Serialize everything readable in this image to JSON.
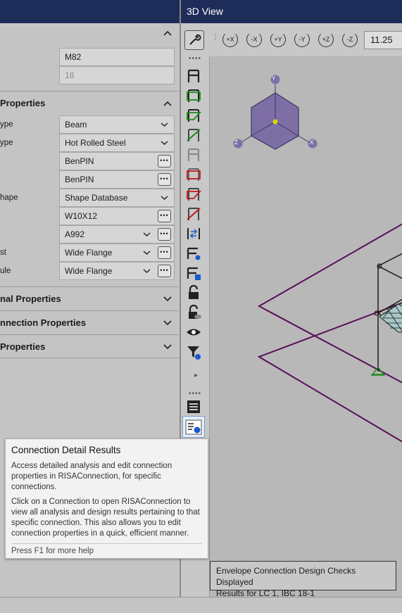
{
  "left_panel": {
    "general_rows": [
      {
        "value": "M82"
      },
      {
        "value": "18"
      }
    ],
    "sections": [
      {
        "title": "Properties",
        "expanded": true
      },
      {
        "title": "nal Properties",
        "expanded": false
      },
      {
        "title": "nnection Properties",
        "expanded": false
      },
      {
        "title": "Properties",
        "expanded": false
      }
    ],
    "member_rows": [
      {
        "label": "ype",
        "value": "Beam",
        "control": "dropdown"
      },
      {
        "label": "ype",
        "value": "Hot Rolled Steel",
        "control": "dropdown"
      },
      {
        "label": "",
        "value": "BenPIN",
        "control": "ellipsis"
      },
      {
        "label": "",
        "value": "BenPIN",
        "control": "ellipsis"
      },
      {
        "label": "hape",
        "value": "Shape Database",
        "control": "dropdown"
      },
      {
        "label": "",
        "value": "W10X12",
        "control": "ellipsis"
      },
      {
        "label": "",
        "value": "A992",
        "control": "both"
      },
      {
        "label": "st",
        "value": "Wide Flange",
        "control": "both"
      },
      {
        "label": "ule",
        "value": "Wide Flange",
        "control": "both"
      }
    ]
  },
  "view": {
    "title": "3D View",
    "zoom": "11.25",
    "rotate_buttons": [
      "+X",
      "-X",
      "+Y",
      "-Y",
      "+Z",
      "-Z"
    ],
    "axis_labels": {
      "y": "Y",
      "z": "Z",
      "x": "X"
    },
    "result_line1": "Envelope Connection Design Checks Displayed",
    "result_line2": "Results for LC 1, IBC 18-1"
  },
  "tooltip": {
    "title": "Connection Detail Results",
    "para1": "Access detailed analysis and edit connection properties in RISAConnection, for specific connections.",
    "para2": "Click on a Connection to open RISAConnection to view all analysis and design results pertaining to that specific connection. This also allows you to edit connection properties in a quick, efficient manner.",
    "help": "Press F1 for more help"
  },
  "colors": {
    "titlebar": "#1e2c5a",
    "cube": "#7d6fa6",
    "model_lines": "#5a0f5a",
    "model_members": "#1a1a1a"
  },
  "icons": {
    "more": "ellipsis-icon",
    "dropdown": "chevron-down-icon",
    "collapse": "chevron-up-icon"
  },
  "more_glyph": "•••",
  "chev_down": "⌄",
  "chev_up": "^"
}
